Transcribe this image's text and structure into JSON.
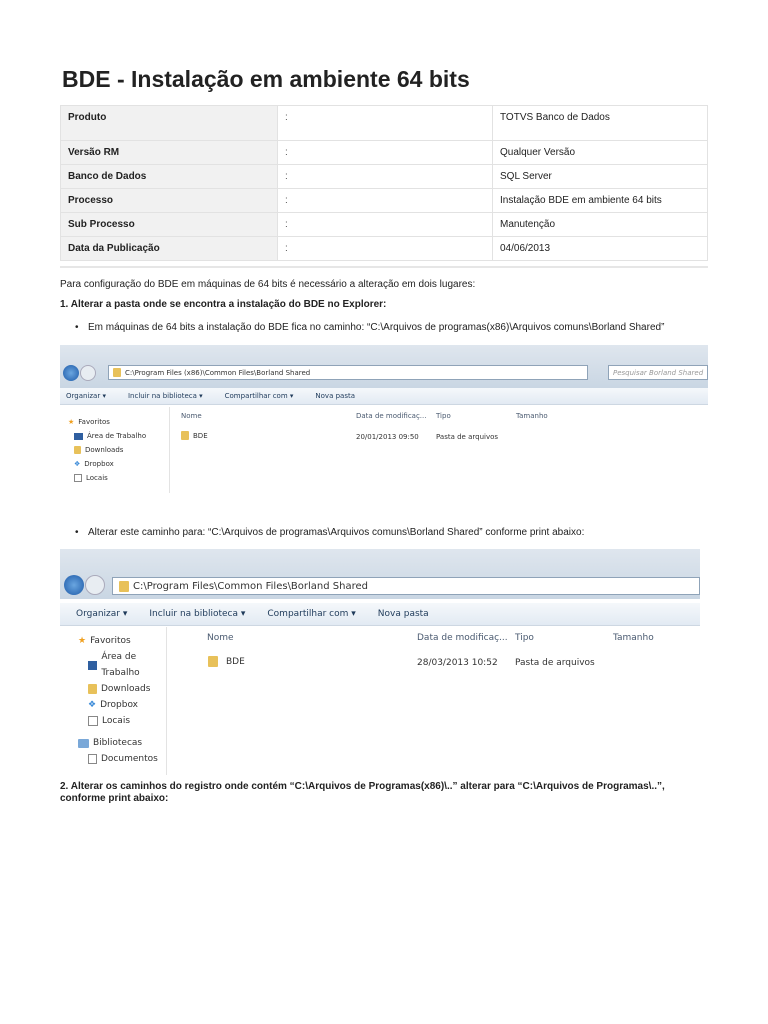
{
  "title": "BDE - Instalação em ambiente 64 bits",
  "meta": [
    {
      "label": "Produto",
      "sep": ":",
      "value": "TOTVS Banco de Dados"
    },
    {
      "label": "Versão RM",
      "sep": ":",
      "value": "Qualquer Versão"
    },
    {
      "label": "Banco de Dados",
      "sep": ":",
      "value": "SQL Server"
    },
    {
      "label": "Processo",
      "sep": ":",
      "value": "Instalação BDE em ambiente 64 bits"
    },
    {
      "label": "Sub Processo",
      "sep": ":",
      "value": "Manutenção"
    },
    {
      "label": "Data da Publicação",
      "sep": ":",
      "value": "04/06/2013"
    }
  ],
  "intro": "Para configuração do BDE em máquinas de 64 bits é necessário a alteração em dois lugares:",
  "step1": "1. Alterar a pasta onde se encontra a instalação do BDE no Explorer:",
  "bullet1": "Em máquinas de 64 bits a instalação do BDE fica no caminho: “C:\\Arquivos de programas(x86)\\Arquivos comuns\\Borland Shared”",
  "bullet2": "Alterar este caminho para: “C:\\Arquivos de programas\\Arquivos comuns\\Borland Shared” conforme print abaixo:",
  "step2": "2. Alterar os caminhos do registro onde contém “C:\\Arquivos de Programas(x86)\\..” alterar para “C:\\Arquivos de Programas\\..”, conforme print abaixo:",
  "shot1": {
    "path": "C:\\Program Files (x86)\\Common Files\\Borland Shared",
    "search": "Pesquisar Borland Shared",
    "toolbar": [
      "Organizar ▾",
      "Incluir na biblioteca ▾",
      "Compartilhar com ▾",
      "Nova pasta"
    ],
    "columns": [
      "Nome",
      "Data de modificaç...",
      "Tipo",
      "Tamanho"
    ],
    "sidebar": [
      "Favoritos",
      "Área de Trabalho",
      "Downloads",
      "Dropbox",
      "Locais"
    ],
    "file": {
      "name": "BDE",
      "date": "20/01/2013 09:50",
      "type": "Pasta de arquivos"
    }
  },
  "shot2": {
    "path": "C:\\Program Files\\Common Files\\Borland Shared",
    "toolbar": [
      "Organizar ▾",
      "Incluir na biblioteca ▾",
      "Compartilhar com ▾",
      "Nova pasta"
    ],
    "columns": [
      "Nome",
      "Data de modificaç...",
      "Tipo",
      "Tamanho"
    ],
    "sidebar": [
      "Favoritos",
      "Área de Trabalho",
      "Downloads",
      "Dropbox",
      "Locais",
      "Bibliotecas",
      "Documentos"
    ],
    "file": {
      "name": "BDE",
      "date": "28/03/2013 10:52",
      "type": "Pasta de arquivos"
    }
  }
}
